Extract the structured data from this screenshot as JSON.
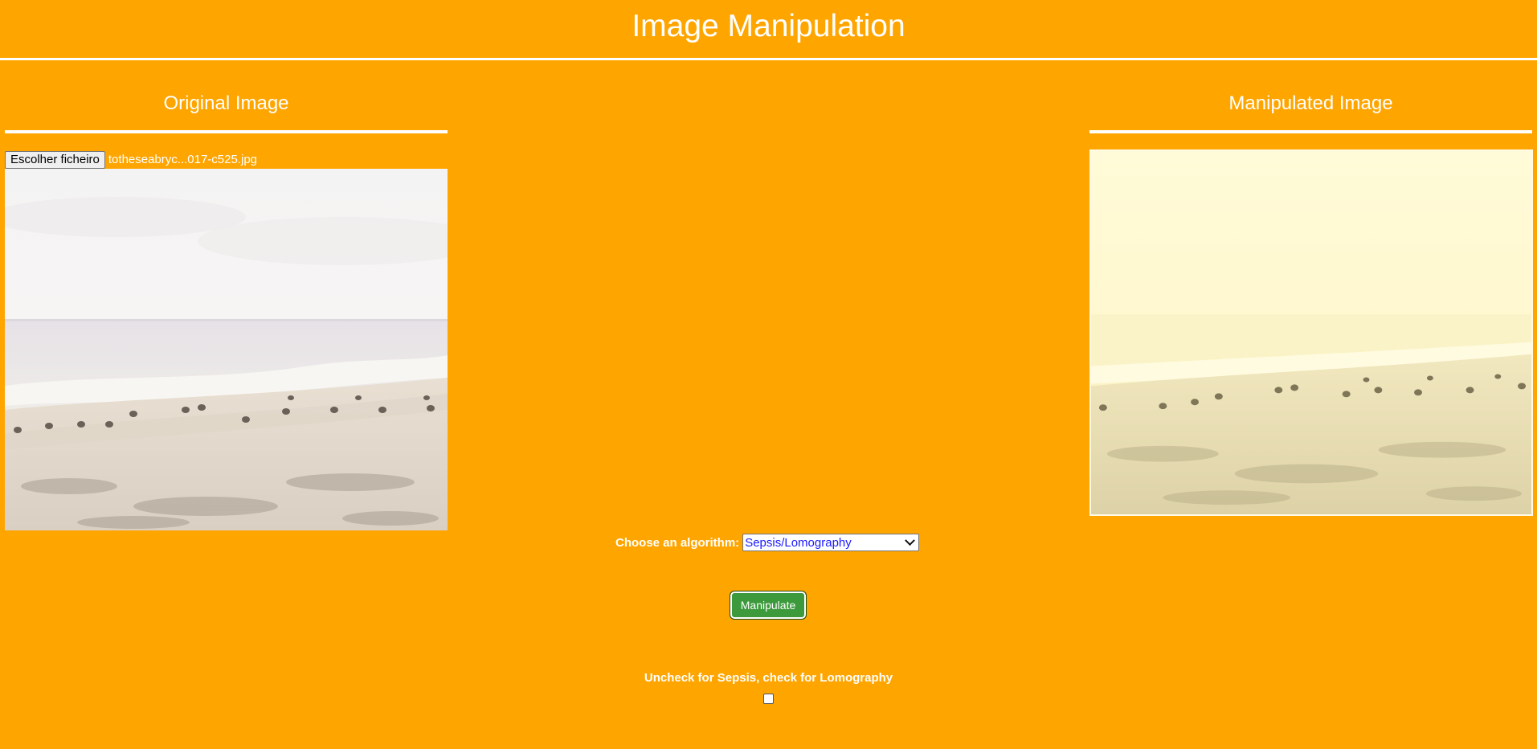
{
  "header": {
    "title": "Image Manipulation"
  },
  "original_panel": {
    "heading": "Original Image",
    "file_button_label": "Escolher ficheiro",
    "file_name": "totheseabryc...017-c525.jpg"
  },
  "manipulated_panel": {
    "heading": "Manipulated Image"
  },
  "controls": {
    "algorithm_label": "Choose an algorithm:",
    "algorithm_selected": "Sepsis/Lomography",
    "manipulate_label": "Manipulate",
    "toggle_label": "Uncheck for Sepsis, check for Lomography",
    "toggle_checked": false
  },
  "colors": {
    "background": "#ffa500",
    "text": "#ffffff",
    "button_green": "#3c9a3c",
    "select_text": "#1a1aff"
  }
}
